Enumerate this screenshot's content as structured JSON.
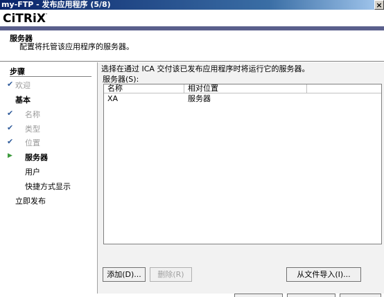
{
  "window": {
    "title": "my-FTP - 发布应用程序 (5/8)",
    "close_glyph": "×"
  },
  "brand": {
    "logo": "CiTRiX",
    "logo_mark": "·"
  },
  "header": {
    "title": "服务器",
    "subtitle": "配置将托管该应用程序的服务器。"
  },
  "sidebar": {
    "heading": "步骤",
    "items": [
      {
        "label": "欢迎",
        "state": "done"
      },
      {
        "label": "基本",
        "state": "group"
      },
      {
        "label": "名称",
        "state": "done"
      },
      {
        "label": "类型",
        "state": "done"
      },
      {
        "label": "位置",
        "state": "done"
      },
      {
        "label": "服务器",
        "state": "current"
      },
      {
        "label": "用户",
        "state": "pending"
      },
      {
        "label": "快捷方式显示",
        "state": "pending"
      },
      {
        "label": "立即发布",
        "state": "pending"
      }
    ],
    "check_glyph": "✔",
    "arrow_glyph": "▶"
  },
  "main": {
    "instruction": "选择在通过 ICA 交付该已发布应用程序时将运行它的服务器。",
    "list_label": "服务器(S):",
    "columns": [
      "名称",
      "相对位置"
    ],
    "rows": [
      {
        "name": "XA",
        "location": "服务器"
      }
    ],
    "buttons": {
      "add": "添加(D)...",
      "remove": "删除(R)",
      "import": "从文件导入(I)..."
    }
  },
  "colors": {
    "titlebar": "#0a246a",
    "band": "#5a5f8c",
    "check": "#2e5a9a",
    "arrow": "#3c9a3c"
  }
}
